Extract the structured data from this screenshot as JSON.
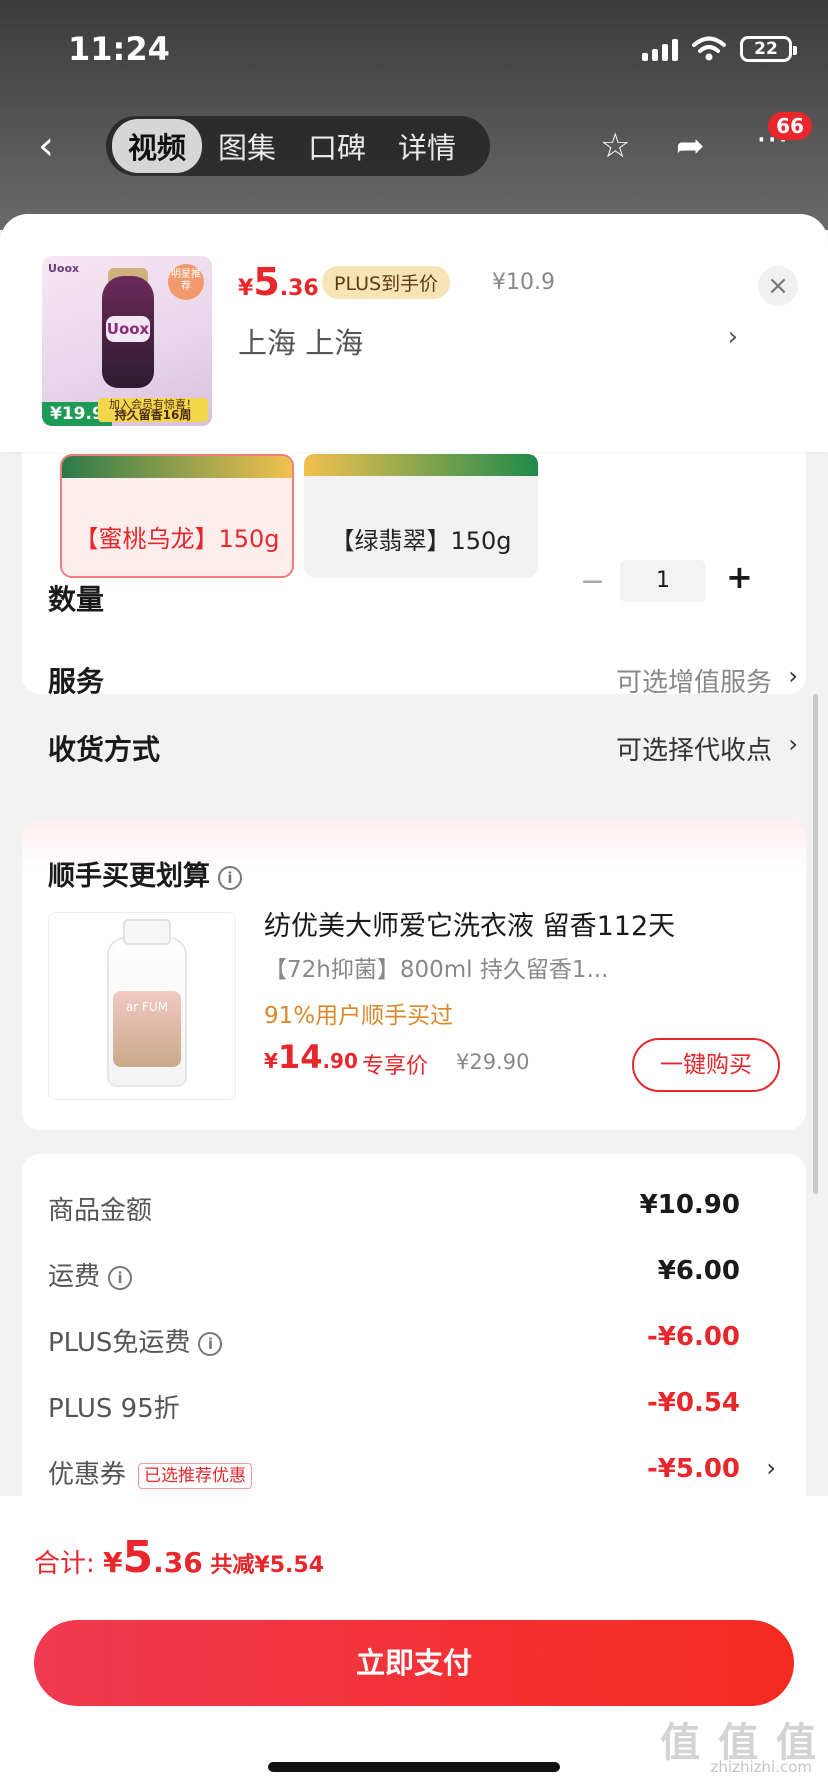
{
  "status": {
    "time": "11:24",
    "battery": "22"
  },
  "nav": {
    "tabs": [
      "视频",
      "图集",
      "口碑",
      "详情"
    ],
    "badge": "66"
  },
  "header": {
    "thumb": {
      "brand": "Uoox",
      "stamp": "明星推荐",
      "price": "¥19.9",
      "banner_line1": "加入会员有惊喜！",
      "banner_line2": "持久留香16周"
    },
    "price_symbol": "¥",
    "price_int": "5",
    "price_dec": ".36",
    "plus_tag": "PLUS到手价",
    "original_price": "¥10.9",
    "location": "上海  上海"
  },
  "specs": {
    "options": [
      "【蜜桃乌龙】150g",
      "【绿翡翠】150g"
    ],
    "quantity_label": "数量",
    "quantity_value": "1",
    "service_label": "服务",
    "service_value": "可选增值服务",
    "delivery_label": "收货方式",
    "delivery_value": "可选择代收点"
  },
  "addon": {
    "title": "顺手买更划算",
    "name": "纺优美大师爱它洗衣液 留香112天",
    "sub": "【72h抑菌】800ml 持久留香1...",
    "bought": "91%用户顺手买过",
    "price_symbol": "¥",
    "price_int": "14",
    "price_dec": ".90",
    "price_tag": "专享价",
    "original": "¥29.90",
    "button": "一键购买",
    "product_label": "ar FUM"
  },
  "summary": {
    "rows": [
      {
        "label": "商品金额",
        "value": "¥10.90"
      },
      {
        "label": "运费",
        "value": "¥6.00"
      },
      {
        "label": "PLUS免运费",
        "value": "-¥6.00"
      },
      {
        "label": "PLUS 95折",
        "value": "-¥0.54"
      },
      {
        "label": "优惠券",
        "value": "-¥5.00",
        "tag": "已选推荐优惠"
      }
    ]
  },
  "bottom": {
    "total_label": "合计: ",
    "total_symbol": "¥",
    "total_int": "5",
    "total_dec": ".36",
    "total_saved": " 共减¥5.54",
    "pay_button": "立即支付"
  },
  "watermark": {
    "main": "值 值 值",
    "sub": "zhizhizhi.com"
  },
  "colors": {
    "accent": "#e8272c",
    "plus_tag_bg": "#f7e4b4",
    "bought": "#d9892b"
  }
}
